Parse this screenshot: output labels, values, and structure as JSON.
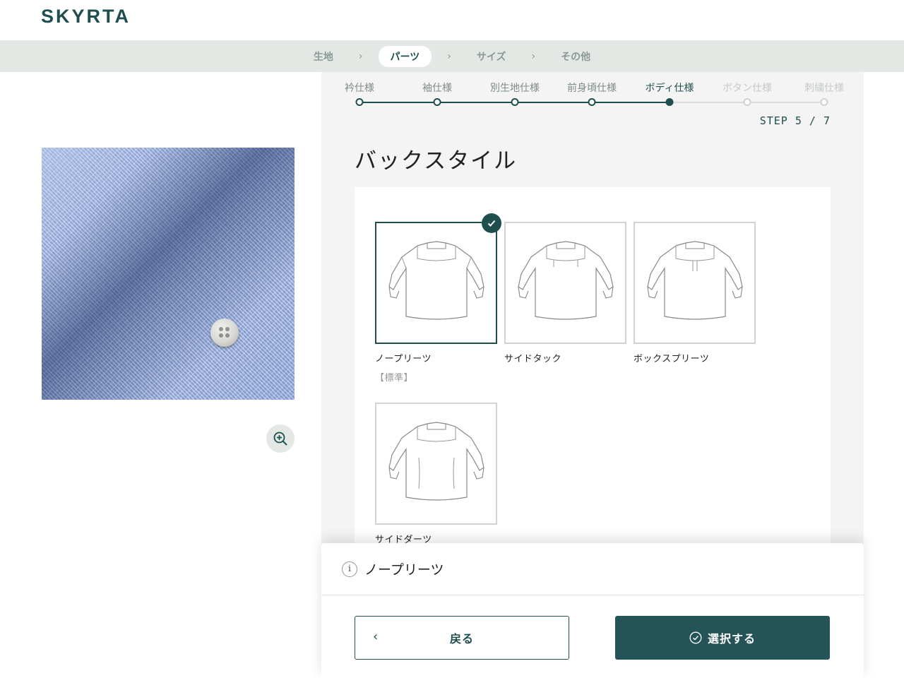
{
  "header": {
    "logo": "SKYRTA"
  },
  "topnav": {
    "items": [
      {
        "label": "生地",
        "active": false
      },
      {
        "label": "パーツ",
        "active": true
      },
      {
        "label": "サイズ",
        "active": false
      },
      {
        "label": "その他",
        "active": false
      }
    ],
    "separator": "›"
  },
  "steps": {
    "items": [
      {
        "label": "衿仕様",
        "state": "done"
      },
      {
        "label": "袖仕様",
        "state": "done"
      },
      {
        "label": "別生地仕様",
        "state": "done"
      },
      {
        "label": "前身頃仕様",
        "state": "done"
      },
      {
        "label": "ボディ仕様",
        "state": "current"
      },
      {
        "label": "ボタン仕様",
        "state": "todo"
      },
      {
        "label": "刺繍仕様",
        "state": "todo"
      }
    ],
    "counter": "STEP 5 / 7"
  },
  "section": {
    "title": "バックスタイル"
  },
  "options": [
    {
      "name": "ノープリーツ",
      "tag": "【標準】",
      "selected": true,
      "style": "no-pleats"
    },
    {
      "name": "サイドタック",
      "tag": "",
      "selected": false,
      "style": "side-tuck"
    },
    {
      "name": "ボックスプリーツ",
      "tag": "",
      "selected": false,
      "style": "box-pleats"
    },
    {
      "name": "サイドダーツ",
      "tag": "",
      "selected": false,
      "style": "side-darts"
    }
  ],
  "sheet": {
    "info_text": "ノープリーツ",
    "back_label": "戻る",
    "select_label": "選択する"
  },
  "colors": {
    "brand": "#1f4e4e",
    "button": "#245458",
    "nav_bg": "#e3e8e5",
    "fabric": "#8ea3d2"
  },
  "icons": {
    "zoom": "zoom-in-icon",
    "check": "check-icon",
    "info": "info-icon",
    "back": "chevron-left-icon",
    "select": "check-circle-icon"
  }
}
